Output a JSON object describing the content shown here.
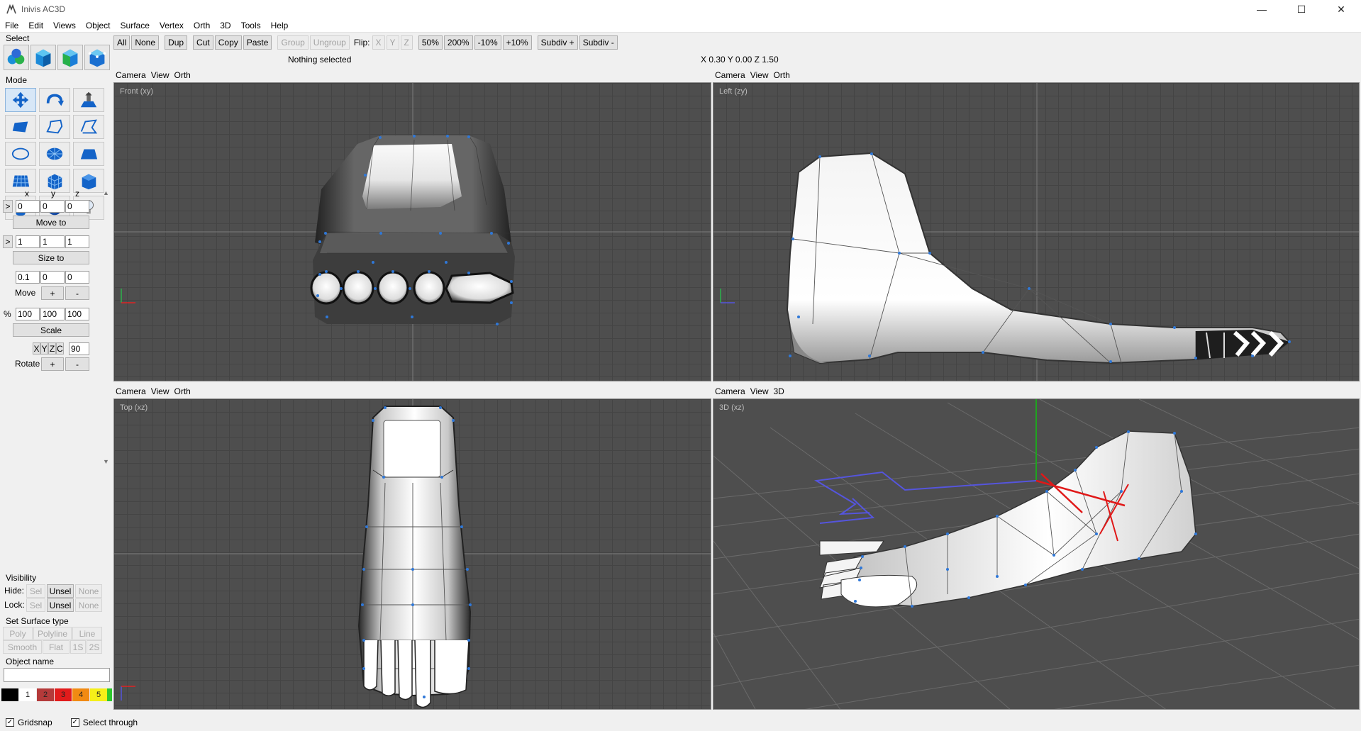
{
  "window": {
    "title": "Inivis AC3D",
    "minimize": "—",
    "maximize": "☐",
    "close": "✕"
  },
  "menu": [
    "File",
    "Edit",
    "Views",
    "Object",
    "Surface",
    "Vertex",
    "Orth",
    "3D",
    "Tools",
    "Help"
  ],
  "toolbar": {
    "all": "All",
    "none": "None",
    "dup": "Dup",
    "cut": "Cut",
    "copy": "Copy",
    "paste": "Paste",
    "group": "Group",
    "ungroup": "Ungroup",
    "flip_label": "Flip:",
    "flip_x": "X",
    "flip_y": "Y",
    "flip_z": "Z",
    "zoom50": "50%",
    "zoom200": "200%",
    "minus10": "-10%",
    "plus10": "+10%",
    "subdiv_plus": "Subdiv +",
    "subdiv_minus": "Subdiv -"
  },
  "status": {
    "selection": "Nothing selected",
    "coords": "X 0.30 Y 0.00 Z 1.50"
  },
  "left_panel": {
    "select_label": "Select",
    "mode_label": "Mode",
    "axis_x": "x",
    "axis_y": "y",
    "axis_z": "z",
    "arrow": ">",
    "pos": [
      "0",
      "0",
      "0"
    ],
    "move_to": "Move to",
    "size": [
      "1",
      "1",
      "1"
    ],
    "size_to": "Size to",
    "step": [
      "0.1",
      "0",
      "0"
    ],
    "move_label": "Move",
    "plus": "+",
    "minus": "-",
    "percent": "%",
    "scale_vals": [
      "100",
      "100",
      "100"
    ],
    "scale": "Scale",
    "rot_x": "X",
    "rot_y": "Y",
    "rot_z": "Z",
    "rot_c": "C",
    "rot_angle": "90",
    "rotate_label": "Rotate",
    "visibility_label": "Visibility",
    "hide_label": "Hide:",
    "lock_label": "Lock:",
    "sel": "Sel",
    "unsel": "Unsel",
    "vnone": "None",
    "surface_label": "Set Surface type",
    "poly": "Poly",
    "polyline": "Polyline",
    "line": "Line",
    "smooth": "Smooth",
    "flat": "Flat",
    "one_s": "1S",
    "two_s": "2S",
    "object_name_label": "Object name",
    "object_name_value": "",
    "swatches": [
      "1",
      "2",
      "3",
      "4",
      "5"
    ]
  },
  "viewports": [
    {
      "camera": "Camera",
      "view": "View",
      "mode": "Orth",
      "label": "Front (xy)"
    },
    {
      "camera": "Camera",
      "view": "View",
      "mode": "Orth",
      "label": "Left (zy)"
    },
    {
      "camera": "Camera",
      "view": "View",
      "mode": "Orth",
      "label": "Top (xz)"
    },
    {
      "camera": "Camera",
      "view": "View",
      "mode": "3D",
      "label": "3D (xz)"
    }
  ],
  "bottom": {
    "gridsnap": "Gridsnap",
    "select_through": "Select through"
  },
  "colors": {
    "viewport_bg": "#4e4e4e",
    "grid_line": "#444444",
    "axis_green": "#1fa31f",
    "axis_blue": "#5555dd",
    "axis_red": "#e01818",
    "vertex": "#2f78d8"
  }
}
